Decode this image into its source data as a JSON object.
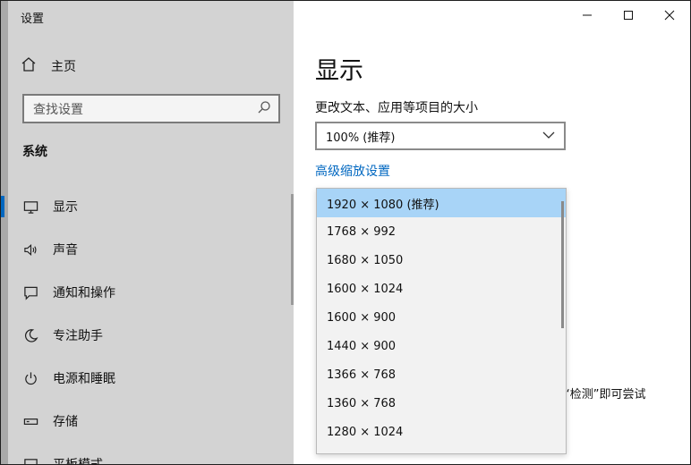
{
  "window": {
    "title": "设置"
  },
  "sidebar": {
    "home_label": "主页",
    "search_placeholder": "查找设置",
    "section_title": "系统",
    "items": [
      {
        "label": "显示",
        "icon": "monitor-icon",
        "active": true
      },
      {
        "label": "声音",
        "icon": "speaker-icon",
        "active": false
      },
      {
        "label": "通知和操作",
        "icon": "notification-icon",
        "active": false
      },
      {
        "label": "专注助手",
        "icon": "moon-icon",
        "active": false
      },
      {
        "label": "电源和睡眠",
        "icon": "power-icon",
        "active": false
      },
      {
        "label": "存储",
        "icon": "storage-icon",
        "active": false
      },
      {
        "label": "平板模式",
        "icon": "tablet-icon",
        "active": false
      }
    ]
  },
  "main": {
    "page_title": "显示",
    "scale_label": "更改文本、应用等项目的大小",
    "scale_value": "100% (推荐)",
    "advanced_link": "高级缩放设置",
    "detect_text": "“检测”即可尝试"
  },
  "resolution_dropdown": {
    "options": [
      "1920 × 1080 (推荐)",
      "1768 × 992",
      "1680 × 1050",
      "1600 × 1024",
      "1600 × 900",
      "1440 × 900",
      "1366 × 768",
      "1360 × 768",
      "1280 × 1024"
    ],
    "selected_index": 0
  },
  "colors": {
    "accent": "#0067c0",
    "sidebar_bg": "#d3d3d3",
    "selected_bg": "#a8d4f7"
  }
}
